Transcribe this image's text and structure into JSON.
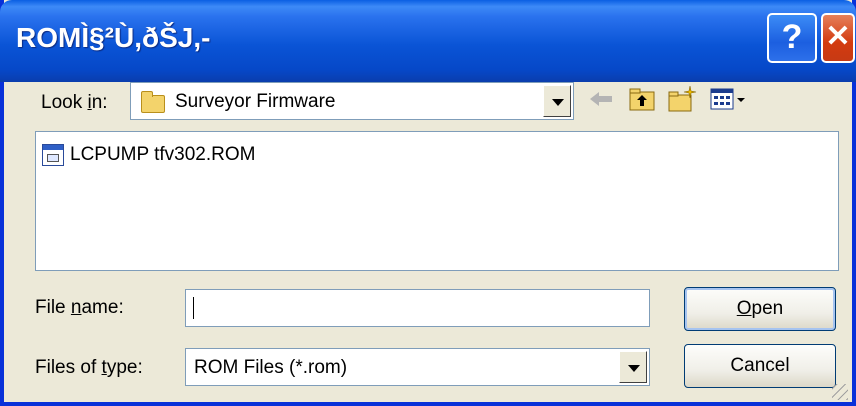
{
  "window": {
    "title": "ROMÌ§²Ù,ðŠJ,-",
    "help_label": "?",
    "close_label": "✕"
  },
  "look_in": {
    "label_pre": "Look ",
    "label_accel": "i",
    "label_post": "n:",
    "value": "Surveyor Firmware"
  },
  "toolbar": {
    "icons": [
      "back-arrow-icon",
      "up-one-level-icon",
      "new-folder-icon",
      "view-menu-icon"
    ]
  },
  "files": [
    {
      "name": "LCPUMP tfv302.ROM",
      "icon": "rom-file-icon"
    }
  ],
  "file_name": {
    "label_pre": "File ",
    "label_accel": "n",
    "label_post": "ame:",
    "value": ""
  },
  "file_type": {
    "label_pre": "Files of ",
    "label_accel": "t",
    "label_post": "ype:",
    "value": "ROM Files (*.rom)"
  },
  "buttons": {
    "open_accel": "O",
    "open_rest": "pen",
    "cancel": "Cancel"
  },
  "colors": {
    "title_bar": "#0a54d6",
    "dialog_bg": "#ece9d8",
    "close_button": "#d33b10"
  }
}
